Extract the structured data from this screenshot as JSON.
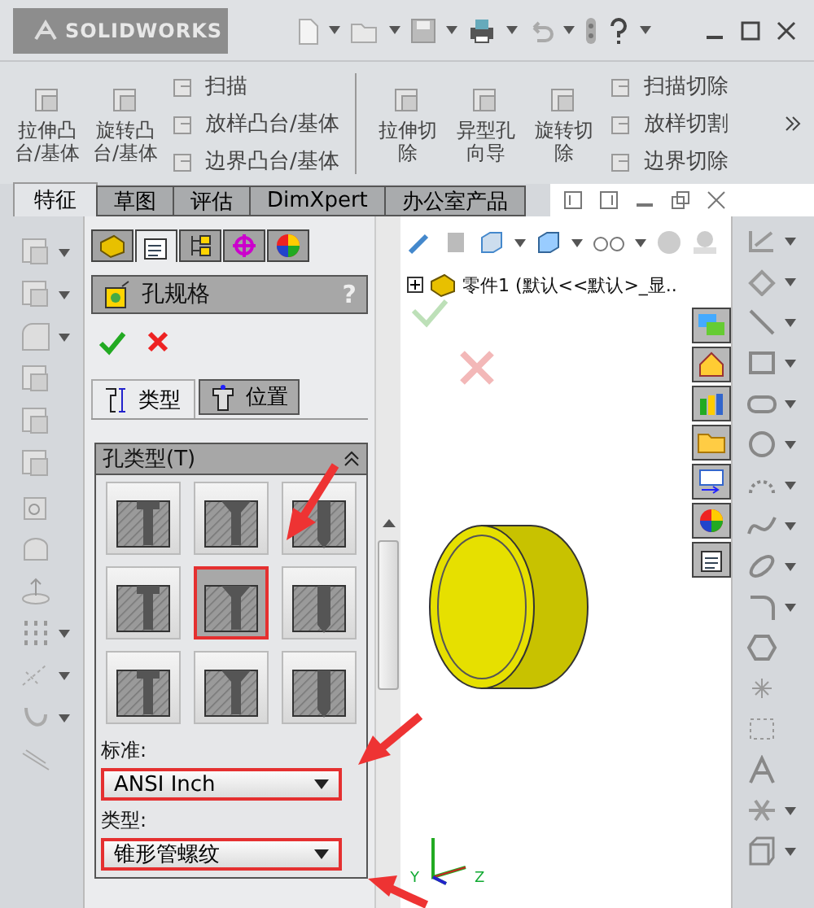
{
  "title_bar": {
    "logo": "SOLIDWORKS"
  },
  "ribbon": {
    "groups": [
      {
        "large": [
          "拉伸凸台/基体",
          "旋转凸台/基体"
        ],
        "small": [
          "扫描",
          "放样凸台/基体",
          "边界凸台/基体"
        ]
      },
      {
        "large": [
          "拉伸切除",
          "异型孔向导",
          "旋转切除"
        ],
        "small": [
          "扫描切除",
          "放样切割",
          "边界切除"
        ]
      }
    ]
  },
  "command_tabs": [
    {
      "label": "特征",
      "selected": true
    },
    {
      "label": "草图",
      "selected": false
    },
    {
      "label": "评估",
      "selected": false
    },
    {
      "label": "DimXpert",
      "selected": false
    },
    {
      "label": "办公室产品",
      "selected": false
    }
  ],
  "property_manager": {
    "tabs": [
      {
        "kind": "tree",
        "selected": false
      },
      {
        "kind": "property",
        "selected": true
      },
      {
        "kind": "config",
        "selected": false
      },
      {
        "kind": "dimxpert",
        "selected": false
      },
      {
        "kind": "display",
        "selected": false
      }
    ],
    "title": "孔规格",
    "help": "?",
    "subtabs": [
      {
        "kind": "type",
        "label": "类型",
        "selected": true
      },
      {
        "kind": "position",
        "label": "位置",
        "selected": false
      }
    ],
    "section": {
      "title": "孔类型(T)",
      "expanded": true
    },
    "hole_types": [
      {
        "selected": false
      },
      {
        "selected": false
      },
      {
        "selected": false
      },
      {
        "selected": false
      },
      {
        "selected": true
      },
      {
        "selected": false
      },
      {
        "selected": false
      },
      {
        "selected": false
      },
      {
        "selected": false
      }
    ],
    "fields": [
      {
        "label": "标准:",
        "value": "ANSI Inch",
        "highlighted": true
      },
      {
        "label": "类型:",
        "value": "锥形管螺纹",
        "highlighted": true
      }
    ]
  },
  "feature_tree": {
    "expanded": false,
    "item": "零件1  (默认<<默认>_显.."
  },
  "triad": [
    "Y",
    "Z"
  ]
}
